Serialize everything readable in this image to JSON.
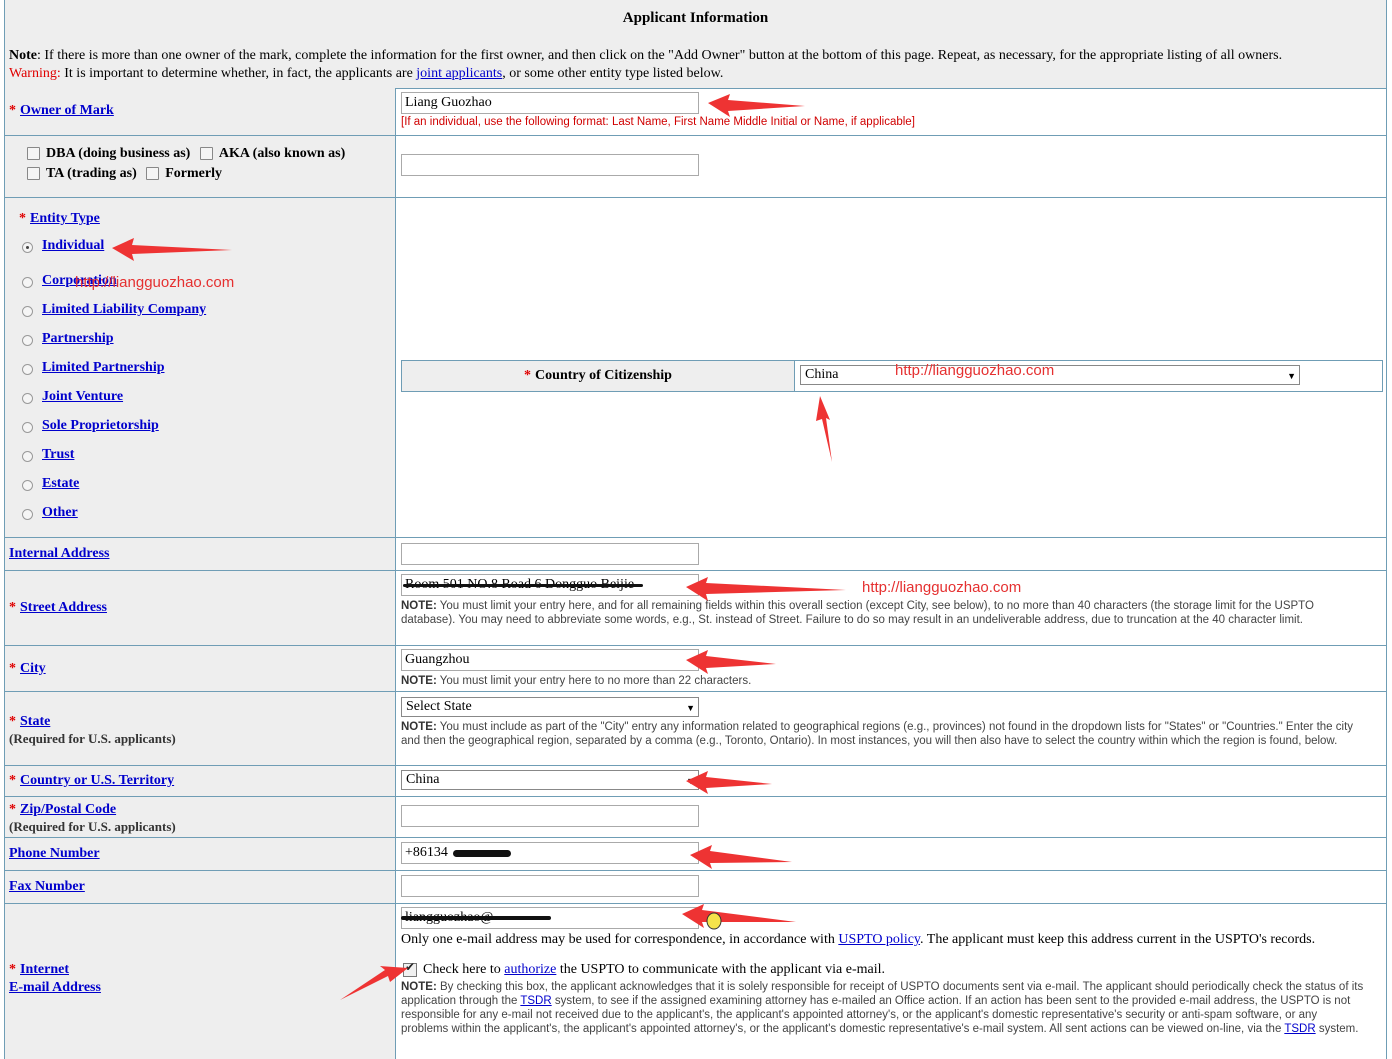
{
  "header": {
    "title": "Applicant Information",
    "note_label": "Note",
    "note_text": ": If there is more than one owner of the mark, complete the information for the first owner, and then click on the \"Add Owner\" button at the bottom of this page. Repeat, as necessary, for the appropriate listing of all owners.",
    "warning_label": "Warning:",
    "warning_pre": " It is important to determine whether, in fact, the applicants are ",
    "warning_link": "joint applicants",
    "warning_post": ", or some other entity type listed below."
  },
  "owner": {
    "label": "Owner of Mark",
    "value": "Liang Guozhao",
    "hint": "[If an individual, use the following format: Last Name, First Name Middle Initial or Name, if applicable]"
  },
  "aliases": {
    "dba": "DBA (doing business as)",
    "aka": "AKA (also known as)",
    "ta": "TA (trading as)",
    "formerly": "Formerly"
  },
  "entity": {
    "label": "Entity Type",
    "options": [
      "Individual",
      "Corporation",
      "Limited Liability Company",
      "Partnership",
      "Limited Partnership",
      "Joint Venture",
      "Sole Proprietorship",
      "Trust",
      "Estate",
      "Other"
    ],
    "selected": "Individual",
    "citizenship_label": "Country of Citizenship",
    "citizenship_value": "China"
  },
  "address": {
    "internal_label": "Internal Address",
    "street_label": "Street Address",
    "street_value": "Room 501 NO.8 Road 6 Dongguo Beijie",
    "street_note_bold": "NOTE:",
    "street_note": " You must limit your entry here, and for all remaining fields within this overall section (except City, see below), to no more than 40 characters (the storage limit for the USPTO database). You may need to abbreviate some words, e.g., St. instead of Street. Failure to do so may result in an undeliverable address, due to truncation at the 40 character limit.",
    "city_label": "City",
    "city_value": "Guangzhou",
    "city_note_bold": "NOTE:",
    "city_note": " You must limit your entry here to no more than 22 characters.",
    "state_label": "State",
    "state_sub": "(Required for U.S. applicants)",
    "state_value": "Select State",
    "state_note_bold": "NOTE:",
    "state_note": " You must include as part of the \"City\" entry any information related to geographical regions (e.g., provinces) not found in the dropdown lists for \"States\" or \"Countries.\" Enter the city and then the geographical region, separated by a comma (e.g., Toronto, Ontario). In most instances, you will then also have to select the country within which the region is found, below.",
    "country_label": "Country or U.S. Territory",
    "country_value": "China",
    "zip_label": "Zip/Postal Code",
    "zip_sub": "(Required for U.S. applicants)"
  },
  "contact": {
    "phone_label": "Phone Number",
    "phone_value": "+86134",
    "fax_label": "Fax Number",
    "email_label_1": "Internet",
    "email_label_2": "E-mail Address",
    "email_value": "liangguozhao@",
    "email_note_pre": "Only one e-mail address may be used for correspondence, in accordance with ",
    "email_note_link": "USPTO policy",
    "email_note_post": ". The applicant must keep this address current in the USPTO's records.",
    "authorize_pre": "Check here to ",
    "authorize_link": "authorize",
    "authorize_post": " the USPTO to communicate with the applicant via e-mail.",
    "auth_note_bold": "NOTE:",
    "auth_note_1": " By checking this box, the applicant acknowledges that it is solely responsible for receipt of USPTO documents sent via e-mail. The applicant should periodically check the status of its application through the ",
    "auth_note_tsdr1": "TSDR",
    "auth_note_2": " system, to see if the assigned examining attorney has e-mailed an Office action. If an action has been sent to the provided e-mail address, the USPTO is not responsible for any e-mail not received due to the applicant's, the applicant's appointed attorney's, or the applicant's domestic representative's security or anti-spam software, or any problems within the applicant's, the applicant's appointed attorney's, or the applicant's domestic representative's e-mail system. All sent actions can be viewed on-line, via the ",
    "auth_note_tsdr2": "TSDR",
    "auth_note_3": " system."
  },
  "watermark": "http://liangguozhao.com",
  "colors": {
    "border": "#6f9db5",
    "label_bg": "#eeeeee",
    "required": "#e00000",
    "arrow": "#ee3333"
  }
}
